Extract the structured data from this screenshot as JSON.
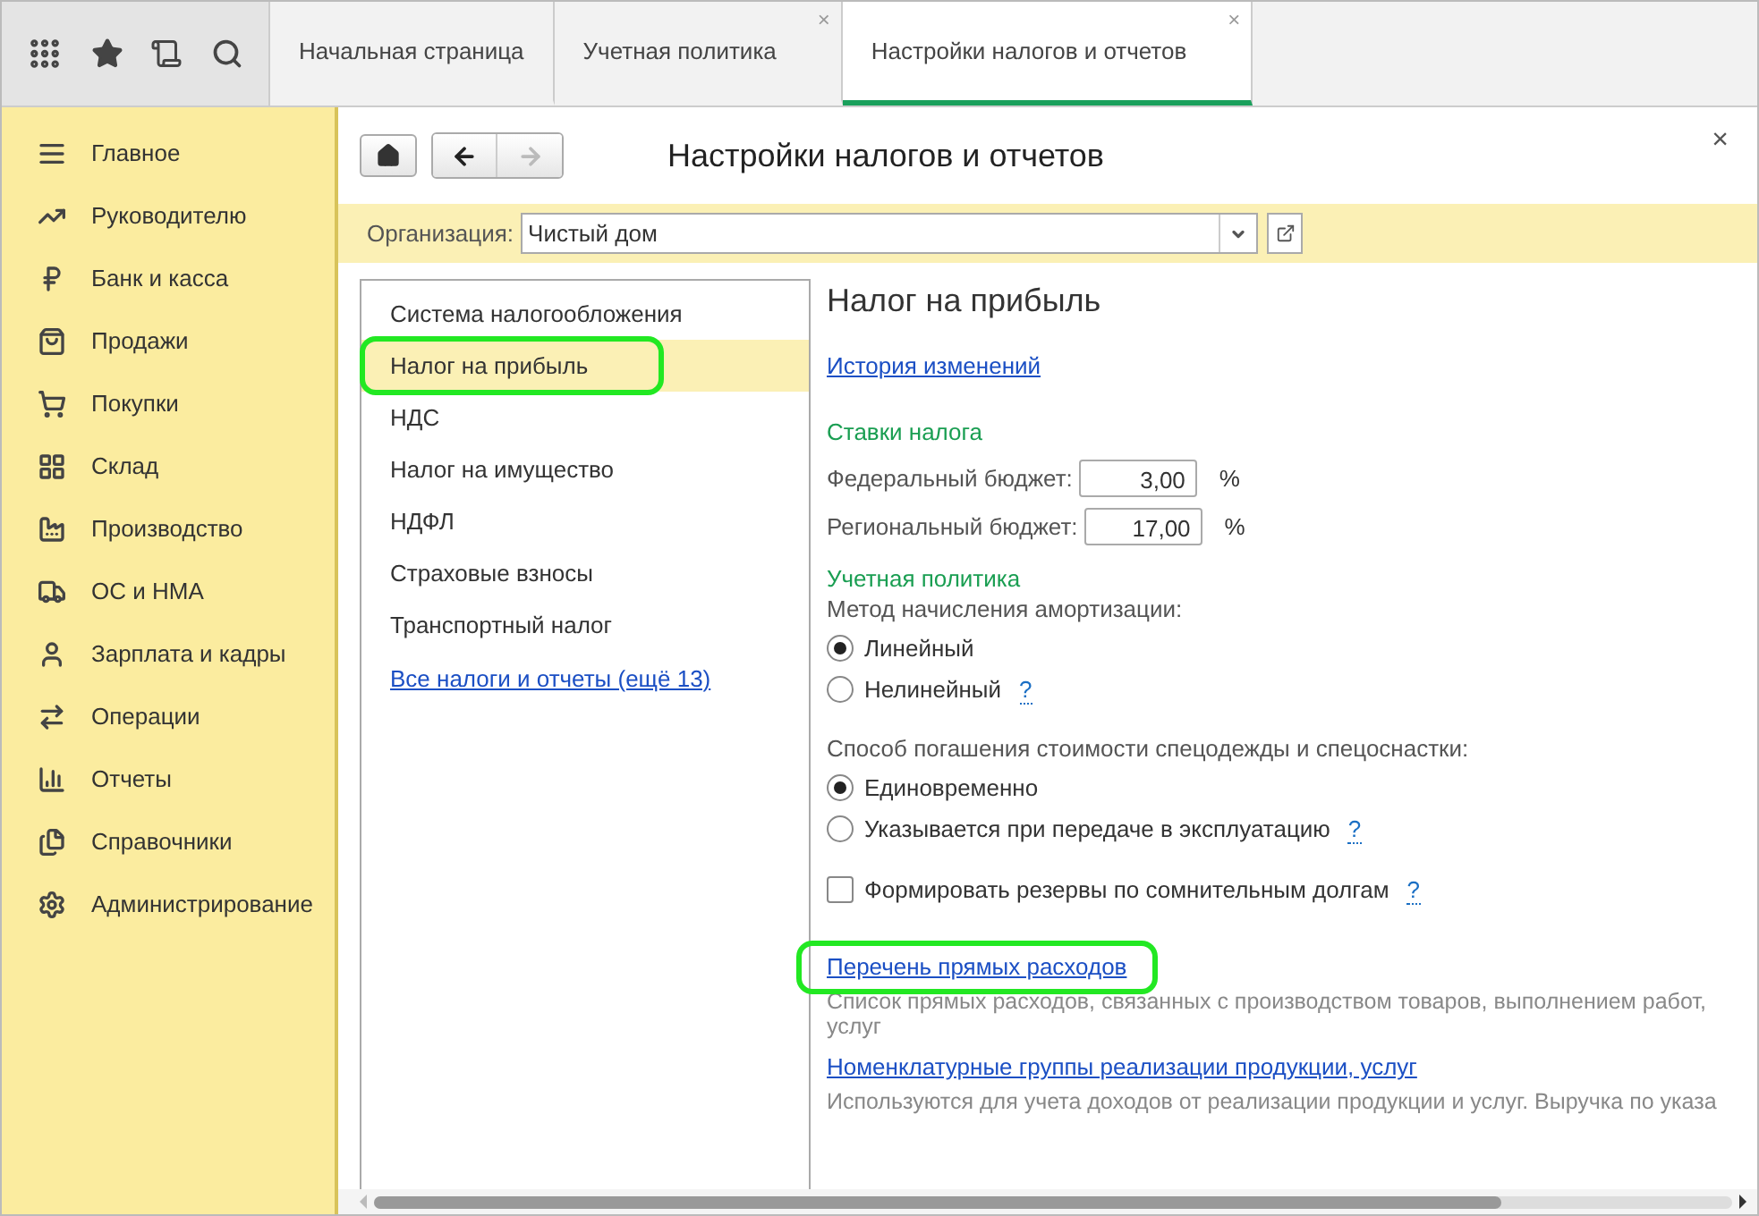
{
  "tabs": [
    {
      "label": "Начальная страница",
      "selected": false
    },
    {
      "label": "Учетная политика",
      "selected": false,
      "close": "×"
    },
    {
      "label": "Настройки налогов и отчетов",
      "selected": true,
      "close": "×"
    }
  ],
  "sidebar": {
    "items": [
      {
        "label": "Главное",
        "kind": "menu"
      },
      {
        "label": "Руководителю",
        "kind": "trend"
      },
      {
        "label": "Банк и касса",
        "kind": "ruble"
      },
      {
        "label": "Продажи",
        "kind": "bag"
      },
      {
        "label": "Покупки",
        "kind": "cart"
      },
      {
        "label": "Склад",
        "kind": "grid"
      },
      {
        "label": "Производство",
        "kind": "factory"
      },
      {
        "label": "ОС и НМА",
        "kind": "truck"
      },
      {
        "label": "Зарплата и кадры",
        "kind": "user"
      },
      {
        "label": "Операции",
        "kind": "ledger"
      },
      {
        "label": "Отчеты",
        "kind": "chart"
      },
      {
        "label": "Справочники",
        "kind": "books"
      },
      {
        "label": "Администрирование",
        "kind": "gear"
      }
    ]
  },
  "page": {
    "title": "Настройки налогов и отчетов",
    "close": "×"
  },
  "organization": {
    "label": "Организация:",
    "value": "Чистый дом"
  },
  "sections": {
    "items": [
      {
        "label": "Система налогообложения",
        "selected": false,
        "highlighted": false
      },
      {
        "label": "Налог на прибыль",
        "selected": true,
        "highlighted": true
      },
      {
        "label": "НДС",
        "selected": false,
        "highlighted": false
      },
      {
        "label": "Налог на имущество",
        "selected": false,
        "highlighted": false
      },
      {
        "label": "НДФЛ",
        "selected": false,
        "highlighted": false
      },
      {
        "label": "Страховые взносы",
        "selected": false,
        "highlighted": false
      },
      {
        "label": "Транспортный налог",
        "selected": false,
        "highlighted": false
      }
    ],
    "more_link": "Все налоги и отчеты (ещё 13)"
  },
  "content": {
    "title": "Налог на прибыль",
    "history_link": "История изменений",
    "rates": {
      "heading": "Ставки налога",
      "rows": [
        {
          "label": "Федеральный бюджет:",
          "value": "3,00",
          "unit": "%"
        },
        {
          "label": "Региональный бюджет:",
          "value": "17,00",
          "unit": "%"
        }
      ]
    },
    "policy": {
      "heading": "Учетная политика",
      "depreciation": {
        "label": "Метод начисления амортизации:",
        "options": [
          {
            "label": "Линейный",
            "selected": true
          },
          {
            "label": "Нелинейный",
            "selected": false,
            "help": "?"
          }
        ]
      },
      "workwear": {
        "label": "Способ погашения стоимости спецодежды и спецоснастки:",
        "options": [
          {
            "label": "Единовременно",
            "selected": true
          },
          {
            "label": "Указывается при передаче в эксплуатацию",
            "selected": false,
            "help": "?"
          }
        ]
      },
      "reserves": {
        "label": "Формировать резервы по сомнительным долгам",
        "checked": false,
        "help": "?"
      }
    },
    "links": [
      {
        "label": "Перечень прямых расходов",
        "highlighted": true,
        "description": [
          "Список прямых расходов, связанных с производством товаров, выполнением работ,",
          "услуг"
        ]
      },
      {
        "label": "Номенклатурные группы реализации продукции, услуг",
        "description": [
          "Используются для учета доходов от реализации продукции и услуг. Выручка по указа"
        ]
      }
    ]
  }
}
